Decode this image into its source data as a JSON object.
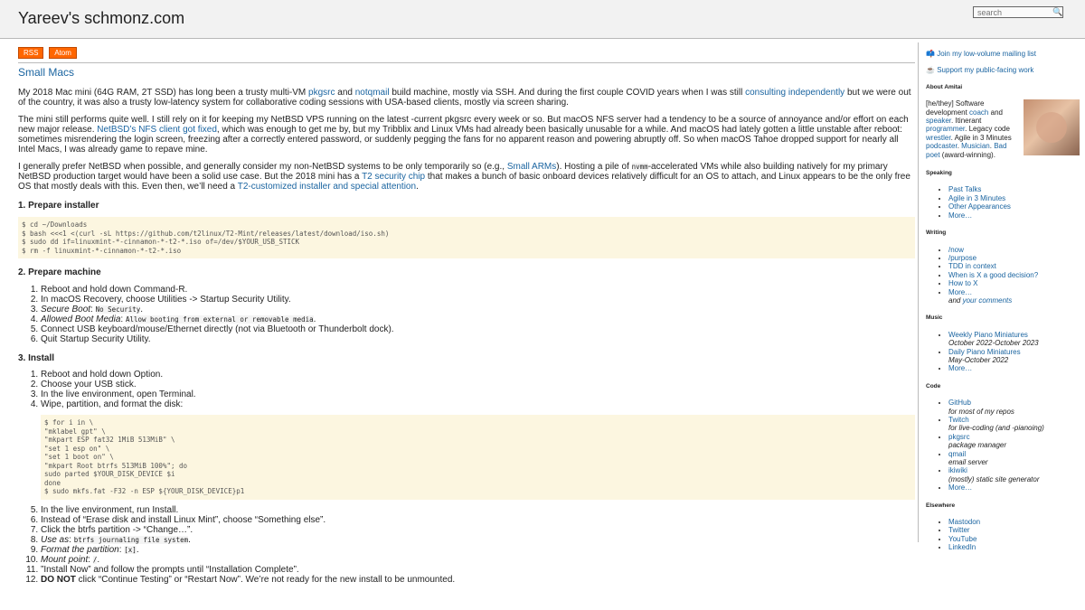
{
  "site": {
    "title": "Yareev's schmonz.com",
    "search_placeholder": "search"
  },
  "feeds": {
    "rss": "RSS",
    "atom": "Atom"
  },
  "post": {
    "title": "Small Macs",
    "p1": {
      "a": "My 2018 Mac mini (64G RAM, 2T SSD) has long been a trusty multi-VM ",
      "l1": "pkgsrc",
      "b": " and ",
      "l2": "notqmail",
      "c": " build machine, mostly via SSH. And during the first couple COVID years when I was still ",
      "l3": "consulting independently",
      "d": " but we were out of the country, it was also a trusty low-latency system for collaborative coding sessions with USA-based clients, mostly via screen sharing."
    },
    "p2": {
      "a": "The mini still performs quite well. I still rely on it for keeping my NetBSD VPS running on the latest -current pkgsrc every week or so. But macOS NFS server had a tendency to be a source of annoyance and/or effort on each new major release. ",
      "l1": "NetBSD’s NFS client got fixed",
      "b": ", which was enough to get me by, but my Tribblix and Linux VMs had already been basically unusable for a while. And macOS had lately gotten a little unstable after reboot: sometimes misrendering the login screen, freezing after a correctly entered password, or suddenly pegging the fans for no apparent reason and powering abruptly off. So when macOS Tahoe dropped support for nearly all Intel Macs, I was already game to repave mine."
    },
    "p3": {
      "a": "I generally prefer NetBSD when possible, and generally consider my non-NetBSD systems to be only temporarily so (e.g., ",
      "l1": "Small ARMs",
      "b": "). Hosting a pile of ",
      "code": "nvmm",
      "c": "-accelerated VMs while also building natively for my primary NetBSD production target would have been a solid use case. But the 2018 mini has a ",
      "l2": "T2 security chip",
      "d": " that makes a bunch of basic onboard devices relatively difficult for an OS to attach, and Linux appears to be the only free OS that mostly deals with this. Even then, we’ll need a ",
      "l3": "T2-customized installer and special attention",
      "e": "."
    },
    "h1": "1. Prepare installer",
    "code1": [
      "$ cd ~/Downloads",
      "$ bash <<<1 <(curl -sL https://github.com/t2linux/T2-Mint/releases/latest/download/iso.sh)",
      "$ sudo dd if=linuxmint-*-cinnamon-*-t2-*.iso of=/dev/$YOUR_USB_STICK",
      "$ rm -f linuxmint-*-cinnamon-*-t2-*.iso"
    ],
    "h2": "2. Prepare machine",
    "list2": [
      {
        "text": "Reboot and hold down Command-R."
      },
      {
        "text": "In macOS Recovery, choose Utilities -> Startup Security Utility."
      },
      {
        "em": "Secure Boot",
        "text": ": ",
        "code": "No Security",
        "after": "."
      },
      {
        "em": "Allowed Boot Media",
        "text": ": ",
        "code": "Allow booting from external or removable media",
        "after": "."
      },
      {
        "text": "Connect USB keyboard/mouse/Ethernet directly (not via Bluetooth or Thunderbolt dock)."
      },
      {
        "text": "Quit Startup Security Utility."
      }
    ],
    "h3": "3. Install",
    "list3a": [
      "Reboot and hold down Option.",
      "Choose your USB stick.",
      "In the live environment, open Terminal.",
      "Wipe, partition, and format the disk:"
    ],
    "code2": [
      "$ for i in \\",
      "\"mklabel gpt\" \\",
      "\"mkpart ESP fat32 1MiB 513MiB\" \\",
      "\"set 1 esp on\" \\",
      "\"set 1 boot on\" \\",
      "\"mkpart Root btrfs 513MiB 100%\"; do",
      "sudo parted $YOUR_DISK_DEVICE $i",
      "done",
      "$ sudo mkfs.fat -F32 -n ESP ${YOUR_DISK_DEVICE}p1"
    ],
    "list3b": [
      {
        "text": "In the live environment, run Install."
      },
      {
        "text": "Instead of “Erase disk and install Linux Mint”, choose “Something else”."
      },
      {
        "text": "Click the btrfs partition -> “Change…”."
      },
      {
        "em": "Use as",
        "text": ": ",
        "code": "btrfs journaling file system",
        "after": "."
      },
      {
        "em": "Format the partition",
        "text": ": ",
        "code": "[x]",
        "after": "."
      },
      {
        "em": "Mount point",
        "text": ": ",
        "code": "/",
        "after": "."
      },
      {
        "text": "”Install Now” and follow the prompts until “Installation Complete”."
      },
      {
        "strong": "DO NOT",
        "text": " click “Continue Testing” or “Restart Now”. We’re not ready for the new install to be unmounted."
      }
    ]
  },
  "sidebar": {
    "mailing": "Join my low-volume mailing list",
    "support": "Support my public-facing work",
    "about_heading": "About Amitai",
    "about": {
      "a": "[he/they] Software development ",
      "l1": "coach",
      "b": " and ",
      "l2": "speaker",
      "c": ". Itinerant ",
      "l3": "programmer",
      "d": ". Legacy code ",
      "l4": "wrestler",
      "e": ". Agile in 3 Minutes ",
      "l5": "podcaster",
      "f": ". ",
      "l6": "Musician",
      "g": ". ",
      "l7": "Bad poet",
      "h": " (award-winning)."
    },
    "speaking_heading": "Speaking",
    "speaking": [
      "Past Talks",
      "Agile in 3 Minutes",
      "Other Appearances",
      "More…"
    ],
    "writing_heading": "Writing",
    "writing": [
      "/now",
      "/purpose",
      "TDD in context",
      "When is X a good decision?",
      "How to X",
      "More…"
    ],
    "writing_extra": {
      "a": "and ",
      "link": "your comments"
    },
    "music_heading": "Music",
    "music": [
      {
        "t": "Weekly Piano Miniatures",
        "s": "October 2022-October 2023"
      },
      {
        "t": "Daily Piano Miniatures",
        "s": "May-October 2022"
      },
      {
        "t": "More…",
        "s": ""
      }
    ],
    "code_heading": "Code",
    "code": [
      {
        "t": "GitHub",
        "s": "for most of my repos"
      },
      {
        "t": "Twitch",
        "s": "for live-coding (and -pianoing)"
      },
      {
        "t": "pkgsrc",
        "s": "package manager"
      },
      {
        "t": "qmail",
        "s": "email server"
      },
      {
        "t": "ikiwiki",
        "s": "(mostly) static site generator"
      },
      {
        "t": "More…",
        "s": ""
      }
    ],
    "elsewhere_heading": "Elsewhere",
    "elsewhere": [
      "Mastodon",
      "Twitter",
      "YouTube",
      "LinkedIn"
    ]
  }
}
